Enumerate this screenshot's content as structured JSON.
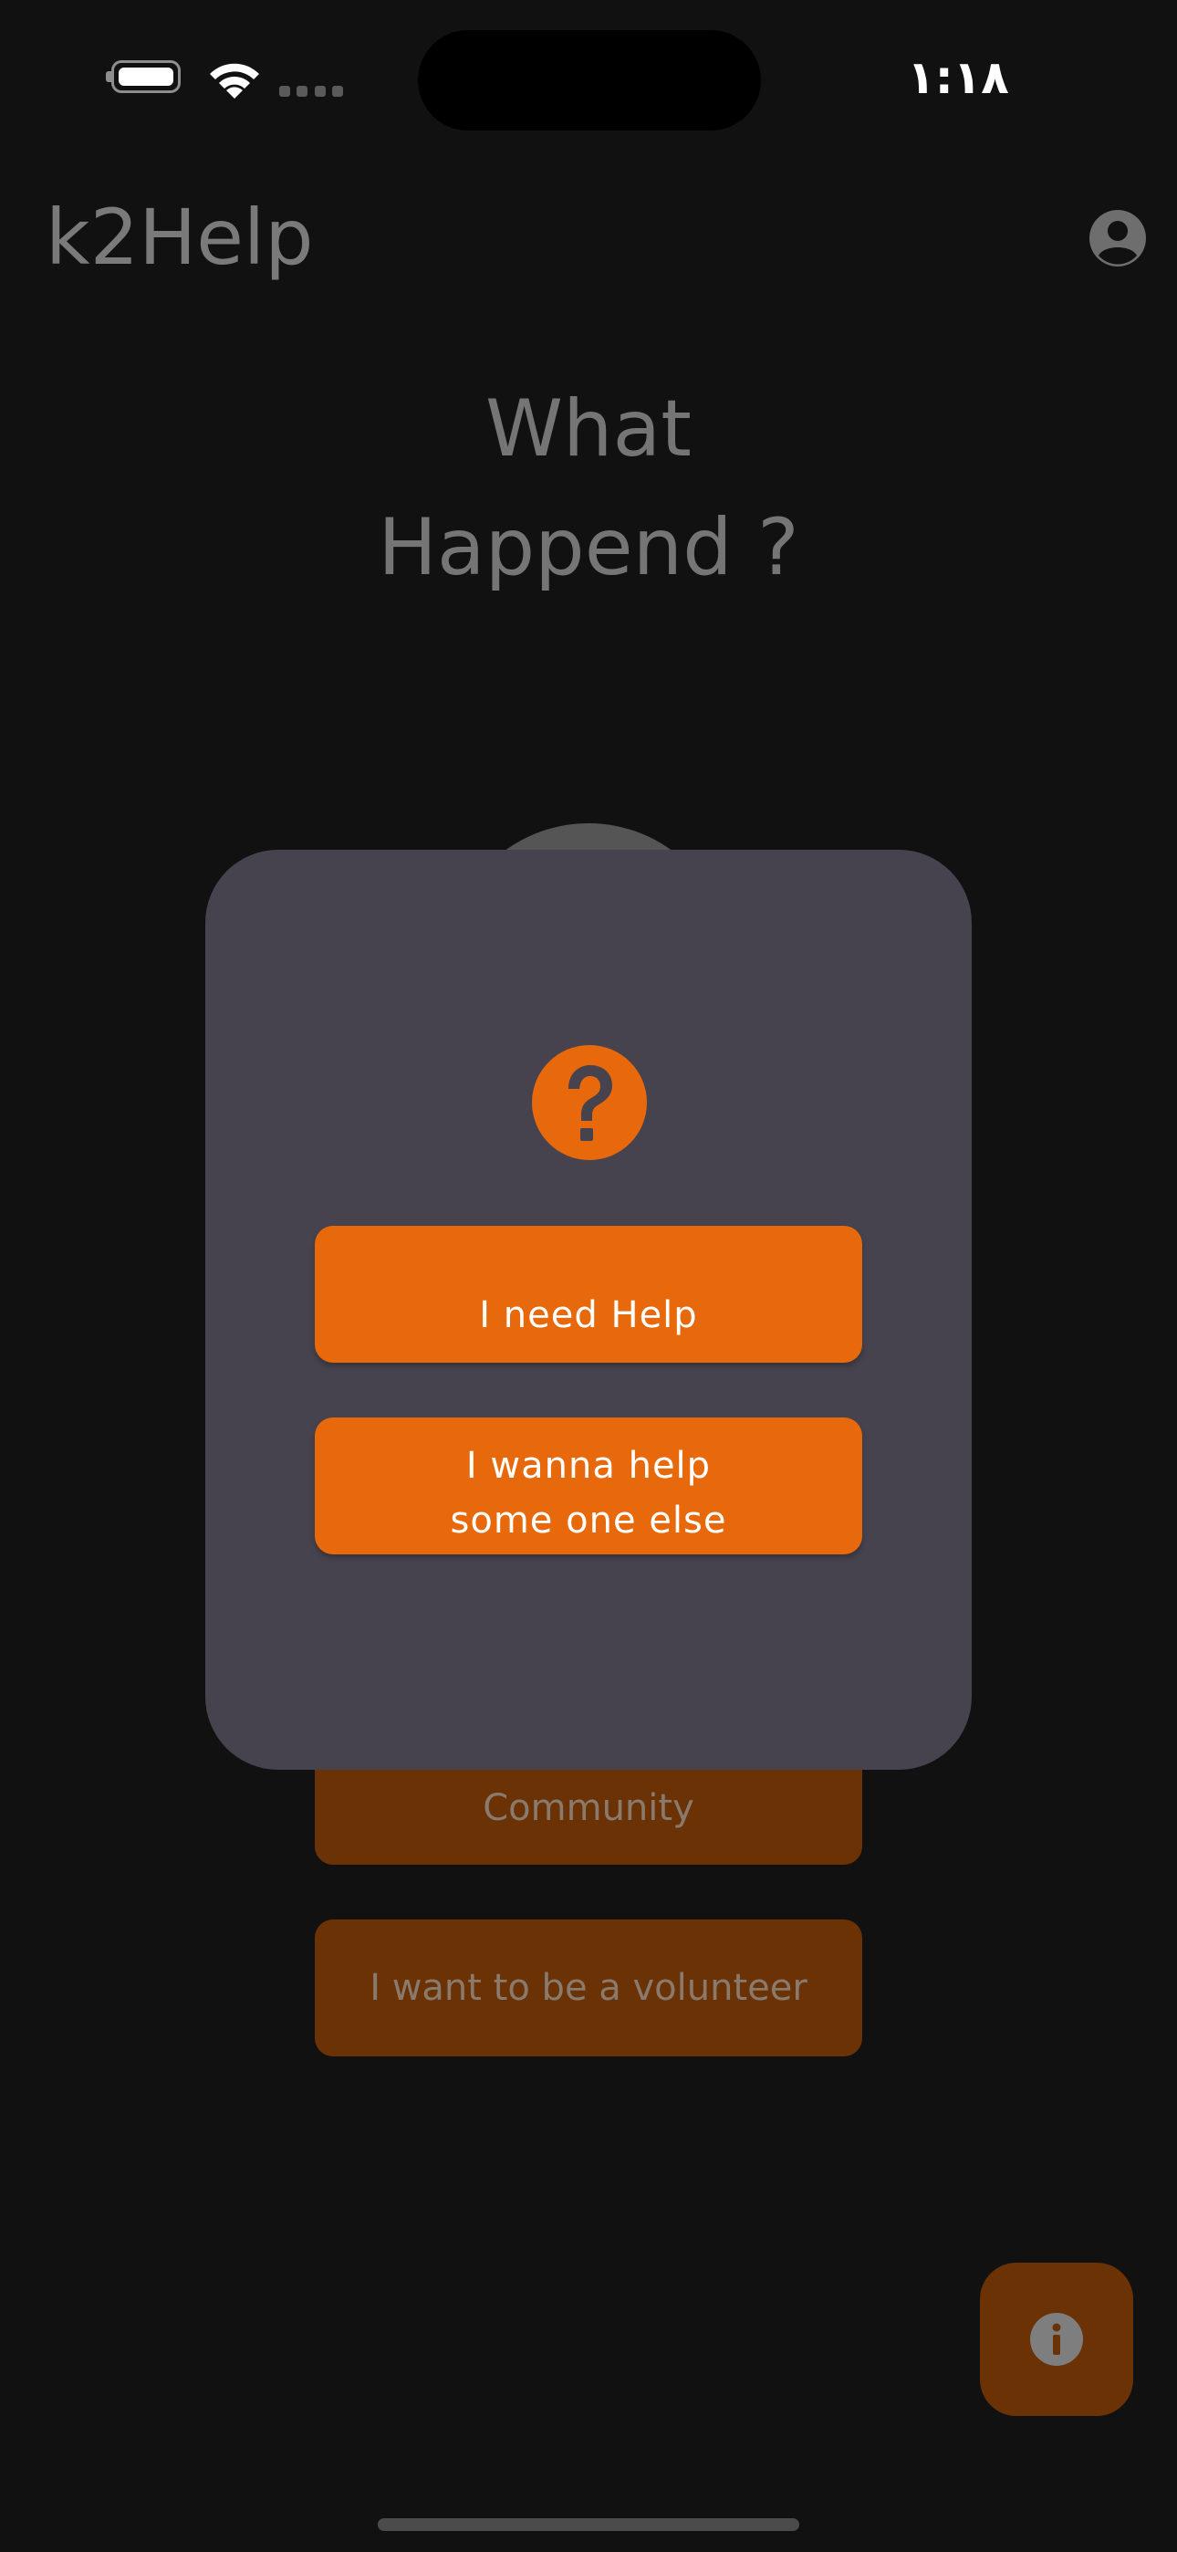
{
  "status_bar": {
    "time": "۱:۱۸",
    "battery_level": 1.0
  },
  "app_bar": {
    "title": "k2Help",
    "profile_icon": "account-circle-icon"
  },
  "heading": {
    "line1": "What",
    "line2": "Happend ?"
  },
  "background": {
    "community_label": "Community",
    "volunteer_label": "I want to be a volunteer",
    "fab_icon": "info-icon"
  },
  "dialog": {
    "icon": "question-icon",
    "need_help_label": "I need Help",
    "help_else_line1": "I wanna help",
    "help_else_line2": "some one else"
  },
  "colors": {
    "accent": "#e8690b",
    "dialog_bg": "#46434f",
    "page_bg": "#111111"
  }
}
